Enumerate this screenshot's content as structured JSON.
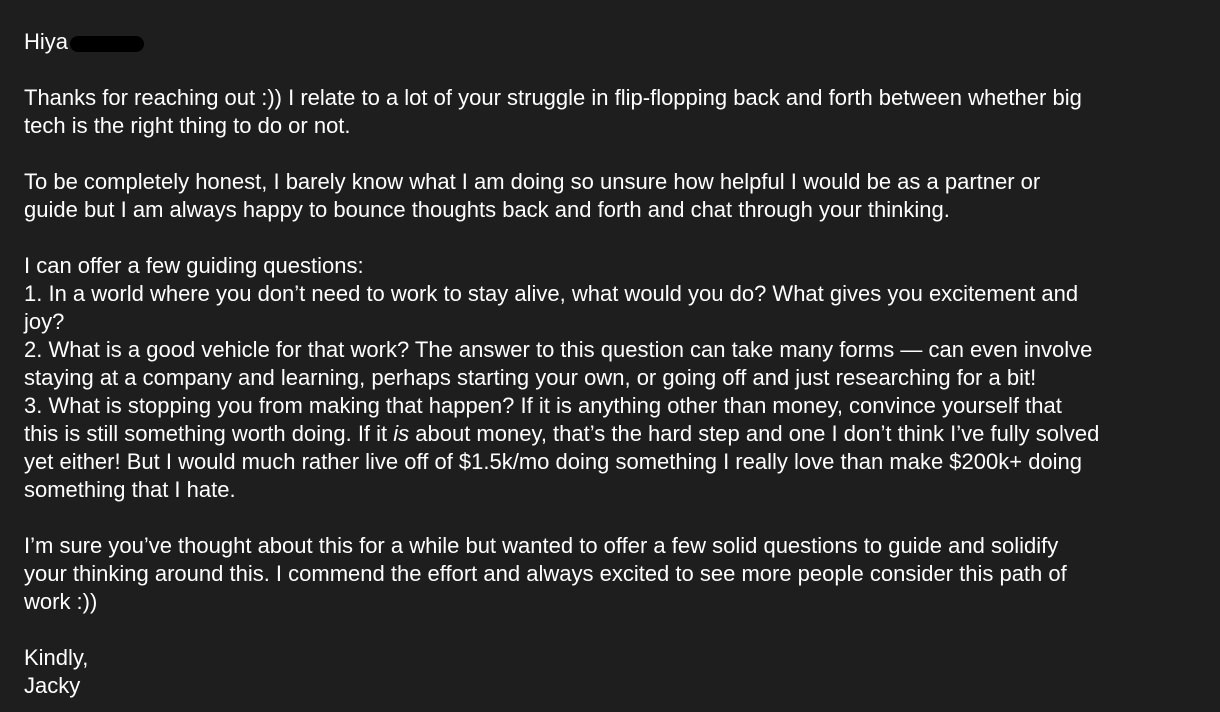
{
  "email": {
    "greeting": "Hiya",
    "p1": [
      "Thanks for reaching out :)) I relate to a lot of your struggle in flip-flopping back and forth between whether big",
      "tech is the right thing to do or not."
    ],
    "p2": [
      "To be completely honest, I barely know what I am doing so unsure how helpful I would be as a partner or",
      "guide but I am always happy to bounce thoughts back and forth and chat through your thinking."
    ],
    "p3": [
      "I can offer a few guiding questions:",
      "1. In a world where you don’t need to work to stay alive, what would you do? What gives you excitement and",
      "joy?",
      "2. What is a good vehicle for that work? The answer to this question can take many forms — can even involve",
      "staying at a company and learning, perhaps starting your own, or going off and just researching for a bit!",
      "3. What is stopping you from making that happen? If it is anything other than money, convince yourself that"
    ],
    "p3_l7_a": "this is still something worth doing. If it ",
    "p3_l7_em": "is",
    "p3_l7_b": " about money, that’s the hard step and one I don’t think I’ve fully solved",
    "p3_tail": [
      "yet either! But I would much rather live off of $1.5k/mo doing something I really love than make $200k+ doing",
      "something that I hate."
    ],
    "p4": [
      "I’m sure you’ve thought about this for a while but wanted to offer a few solid questions to guide and solidify",
      "your thinking around this. I commend the effort and always excited to see more people consider this path of",
      "work :))"
    ],
    "signoff": "Kindly,",
    "signature": "Jacky"
  }
}
